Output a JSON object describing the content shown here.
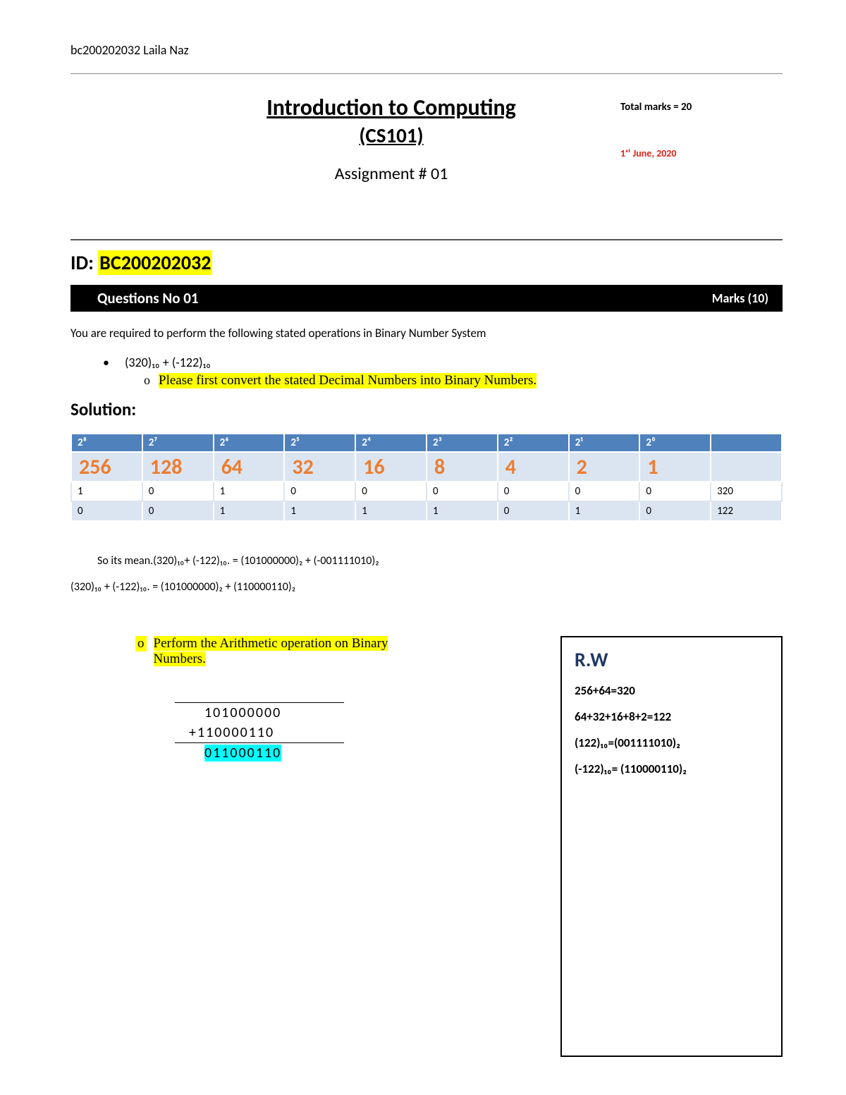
{
  "student_header": "bc200202032 Laila Naz",
  "title": {
    "main": "Introduction to Computing",
    "course": "(CS101)",
    "assignment": "Assignment # 01",
    "total_marks": "Total marks = 20",
    "date": "1ˢᵗ June, 2020"
  },
  "id": {
    "prefix": "ID: ",
    "value": "BC200202032"
  },
  "qbar": {
    "title": "Questions No 01",
    "marks": "Marks (10)"
  },
  "instr": "You are required to perform the following stated operations in Binary Number System",
  "bullet": "(320)₁₀ + (-122)₁₀",
  "subbullet": "Please first convert the stated Decimal Numbers into Binary Numbers.",
  "solution_h": "Solution:",
  "table": {
    "powers": [
      "2⁸",
      "2⁷",
      "2⁶",
      "2⁵",
      "2⁴",
      "2³",
      "2²",
      "2¹",
      "2⁰",
      ""
    ],
    "vals": [
      "256",
      "128",
      "64",
      "32",
      "16",
      "8",
      "4",
      "2",
      "1",
      ""
    ],
    "row1": [
      "1",
      "0",
      "1",
      "0",
      "0",
      "0",
      "0",
      "0",
      "0",
      "320"
    ],
    "row2": [
      "0",
      "0",
      "1",
      "1",
      "1",
      "1",
      "0",
      "1",
      "0",
      "122"
    ]
  },
  "meanline": "So its mean.(320)₁₀+ (-122)₁₀.  =  (101000000)₂ + (-001111010)₂",
  "eqline": "(320)₁₀ + (-122)₁₀.  =  (101000000)₂ + (110000110)₂",
  "perform": "Perform the Arithmetic operation on Binary Numbers.",
  "arith": {
    "a": "101000000",
    "b": "+110000110",
    "r": "011000110"
  },
  "rw": {
    "title": "R.W",
    "l1": "256+64=320",
    "l2": "64+32+16+8+2=122",
    "l3": "(122)₁₀=(001111010)₂",
    "l4": "(-122)₁₀= (110000110)₂"
  }
}
